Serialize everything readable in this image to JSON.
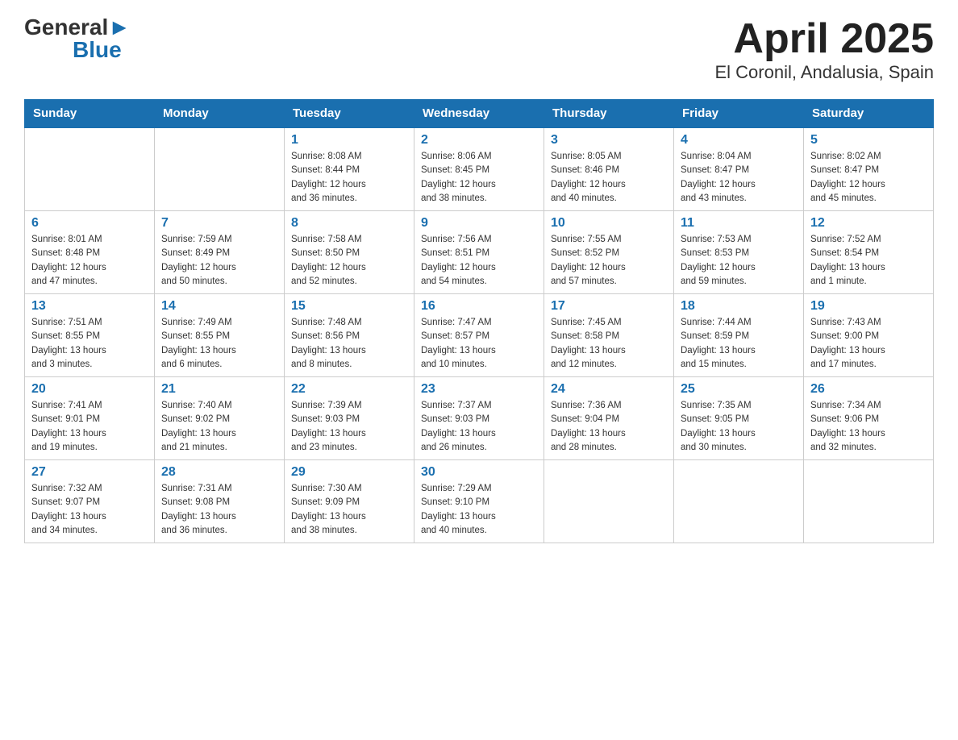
{
  "header": {
    "logo_general": "General",
    "logo_blue": "Blue",
    "title": "April 2025",
    "subtitle": "El Coronil, Andalusia, Spain"
  },
  "weekdays": [
    "Sunday",
    "Monday",
    "Tuesday",
    "Wednesday",
    "Thursday",
    "Friday",
    "Saturday"
  ],
  "weeks": [
    [
      {
        "day": "",
        "info": ""
      },
      {
        "day": "",
        "info": ""
      },
      {
        "day": "1",
        "info": "Sunrise: 8:08 AM\nSunset: 8:44 PM\nDaylight: 12 hours\nand 36 minutes."
      },
      {
        "day": "2",
        "info": "Sunrise: 8:06 AM\nSunset: 8:45 PM\nDaylight: 12 hours\nand 38 minutes."
      },
      {
        "day": "3",
        "info": "Sunrise: 8:05 AM\nSunset: 8:46 PM\nDaylight: 12 hours\nand 40 minutes."
      },
      {
        "day": "4",
        "info": "Sunrise: 8:04 AM\nSunset: 8:47 PM\nDaylight: 12 hours\nand 43 minutes."
      },
      {
        "day": "5",
        "info": "Sunrise: 8:02 AM\nSunset: 8:47 PM\nDaylight: 12 hours\nand 45 minutes."
      }
    ],
    [
      {
        "day": "6",
        "info": "Sunrise: 8:01 AM\nSunset: 8:48 PM\nDaylight: 12 hours\nand 47 minutes."
      },
      {
        "day": "7",
        "info": "Sunrise: 7:59 AM\nSunset: 8:49 PM\nDaylight: 12 hours\nand 50 minutes."
      },
      {
        "day": "8",
        "info": "Sunrise: 7:58 AM\nSunset: 8:50 PM\nDaylight: 12 hours\nand 52 minutes."
      },
      {
        "day": "9",
        "info": "Sunrise: 7:56 AM\nSunset: 8:51 PM\nDaylight: 12 hours\nand 54 minutes."
      },
      {
        "day": "10",
        "info": "Sunrise: 7:55 AM\nSunset: 8:52 PM\nDaylight: 12 hours\nand 57 minutes."
      },
      {
        "day": "11",
        "info": "Sunrise: 7:53 AM\nSunset: 8:53 PM\nDaylight: 12 hours\nand 59 minutes."
      },
      {
        "day": "12",
        "info": "Sunrise: 7:52 AM\nSunset: 8:54 PM\nDaylight: 13 hours\nand 1 minute."
      }
    ],
    [
      {
        "day": "13",
        "info": "Sunrise: 7:51 AM\nSunset: 8:55 PM\nDaylight: 13 hours\nand 3 minutes."
      },
      {
        "day": "14",
        "info": "Sunrise: 7:49 AM\nSunset: 8:55 PM\nDaylight: 13 hours\nand 6 minutes."
      },
      {
        "day": "15",
        "info": "Sunrise: 7:48 AM\nSunset: 8:56 PM\nDaylight: 13 hours\nand 8 minutes."
      },
      {
        "day": "16",
        "info": "Sunrise: 7:47 AM\nSunset: 8:57 PM\nDaylight: 13 hours\nand 10 minutes."
      },
      {
        "day": "17",
        "info": "Sunrise: 7:45 AM\nSunset: 8:58 PM\nDaylight: 13 hours\nand 12 minutes."
      },
      {
        "day": "18",
        "info": "Sunrise: 7:44 AM\nSunset: 8:59 PM\nDaylight: 13 hours\nand 15 minutes."
      },
      {
        "day": "19",
        "info": "Sunrise: 7:43 AM\nSunset: 9:00 PM\nDaylight: 13 hours\nand 17 minutes."
      }
    ],
    [
      {
        "day": "20",
        "info": "Sunrise: 7:41 AM\nSunset: 9:01 PM\nDaylight: 13 hours\nand 19 minutes."
      },
      {
        "day": "21",
        "info": "Sunrise: 7:40 AM\nSunset: 9:02 PM\nDaylight: 13 hours\nand 21 minutes."
      },
      {
        "day": "22",
        "info": "Sunrise: 7:39 AM\nSunset: 9:03 PM\nDaylight: 13 hours\nand 23 minutes."
      },
      {
        "day": "23",
        "info": "Sunrise: 7:37 AM\nSunset: 9:03 PM\nDaylight: 13 hours\nand 26 minutes."
      },
      {
        "day": "24",
        "info": "Sunrise: 7:36 AM\nSunset: 9:04 PM\nDaylight: 13 hours\nand 28 minutes."
      },
      {
        "day": "25",
        "info": "Sunrise: 7:35 AM\nSunset: 9:05 PM\nDaylight: 13 hours\nand 30 minutes."
      },
      {
        "day": "26",
        "info": "Sunrise: 7:34 AM\nSunset: 9:06 PM\nDaylight: 13 hours\nand 32 minutes."
      }
    ],
    [
      {
        "day": "27",
        "info": "Sunrise: 7:32 AM\nSunset: 9:07 PM\nDaylight: 13 hours\nand 34 minutes."
      },
      {
        "day": "28",
        "info": "Sunrise: 7:31 AM\nSunset: 9:08 PM\nDaylight: 13 hours\nand 36 minutes."
      },
      {
        "day": "29",
        "info": "Sunrise: 7:30 AM\nSunset: 9:09 PM\nDaylight: 13 hours\nand 38 minutes."
      },
      {
        "day": "30",
        "info": "Sunrise: 7:29 AM\nSunset: 9:10 PM\nDaylight: 13 hours\nand 40 minutes."
      },
      {
        "day": "",
        "info": ""
      },
      {
        "day": "",
        "info": ""
      },
      {
        "day": "",
        "info": ""
      }
    ]
  ]
}
